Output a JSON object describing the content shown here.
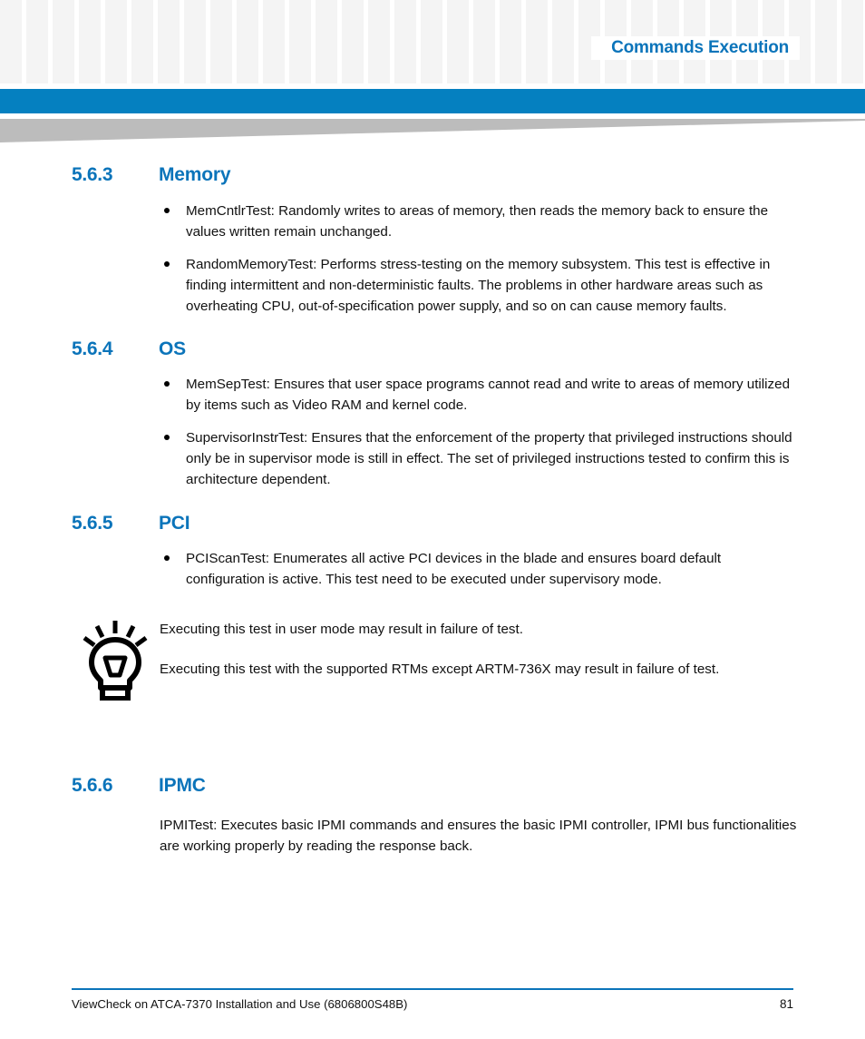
{
  "header": {
    "running_title": "Commands Execution",
    "accent_color": "#0580c0",
    "heading_color": "#0b74ba",
    "pattern_color": "#f4f4f4",
    "swoosh_color": "#bcbcbc"
  },
  "sections": [
    {
      "number": "5.6.3",
      "title": "Memory",
      "bullets": [
        "MemCntlrTest: Randomly writes to areas of memory, then reads the memory back to ensure the values written remain unchanged.",
        "RandomMemoryTest: Performs stress-testing on the memory subsystem. This test is effective in finding intermittent and non-deterministic faults. The problems in other hardware areas such as overheating CPU, out-of-specification power supply, and so on can cause memory faults."
      ]
    },
    {
      "number": "5.6.4",
      "title": "OS",
      "bullets": [
        "MemSepTest: Ensures that user space programs cannot read and write to areas of memory utilized by items such as Video RAM and kernel code.",
        "SupervisorInstrTest: Ensures that the enforcement of the property that privileged instructions should only be in supervisor mode is still in effect. The set of privileged instructions tested to confirm this is architecture dependent."
      ]
    },
    {
      "number": "5.6.5",
      "title": "PCI",
      "bullets": [
        "PCIScanTest: Enumerates all active PCI devices in the blade and ensures board default configuration is active. This test need to be executed under supervisory mode."
      ]
    },
    {
      "number": "5.6.6",
      "title": "IPMC",
      "paragraph": "IPMITest: Executes basic IPMI commands and ensures the basic IPMI controller, IPMI bus functionalities are working properly by reading the response back."
    }
  ],
  "tip": {
    "icon": "lightbulb-tip-icon",
    "lines": [
      "Executing this test in user mode may result in failure of test.",
      "Executing this test with the supported RTMs except ARTM-736X may result in failure of test."
    ]
  },
  "footer": {
    "document_title": "ViewCheck on ATCA-7370 Installation and Use (6806800S48B)",
    "page_number": "81"
  }
}
